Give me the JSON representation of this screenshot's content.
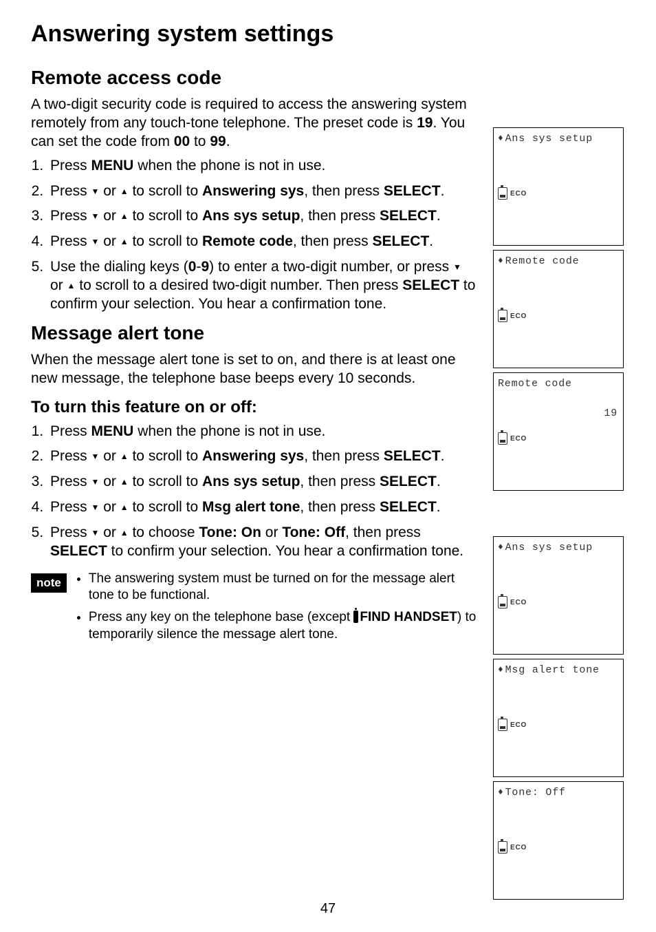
{
  "title": "Answering system settings",
  "section1": {
    "heading": "Remote access code",
    "intro_pre": "A two-digit security code is required to access the answering system remotely from any touch-tone telephone. The preset code is ",
    "intro_code": "19",
    "intro_mid": ". You can set the code from ",
    "intro_from": "00",
    "intro_to_word": " to ",
    "intro_to": "99",
    "intro_end": ".",
    "steps": {
      "s1_pre": "Press ",
      "s1_bold": "MENU",
      "s1_post": " when the phone is not in use.",
      "s2_pre": "Press ",
      "s2_or": " or ",
      "s2_mid": " to scroll to ",
      "s2_bold": "Answering sys",
      "s2_then": ", then press ",
      "s2_sel": "SELECT",
      "s2_end": ".",
      "s3_bold": "Ans sys setup",
      "s4_bold": "Remote code",
      "s5_a": "Use the dialing keys (",
      "s5_zero": "0",
      "s5_dash": "-",
      "s5_nine": "9",
      "s5_b": ") to enter a two-digit number, or press ",
      "s5_c": " to scroll to a desired two-digit number. Then press ",
      "s5_sel": "SELECT",
      "s5_d": " to confirm your selection. You hear a confirmation tone."
    }
  },
  "section2": {
    "heading": "Message alert tone",
    "intro": "When the message alert tone is set to on, and there is at least one new message, the telephone base beeps every 10 seconds.",
    "subheading": "To turn this feature on or off:",
    "steps": {
      "s1_pre": "Press ",
      "s1_bold": "MENU",
      "s1_post": " when the phone is not in use.",
      "scroll_pre": "Press ",
      "scroll_or": " or ",
      "scroll_mid": " to scroll to ",
      "then": ", then press ",
      "sel": "SELECT",
      "end": ".",
      "s2_bold": "Answering sys",
      "s3_bold": "Ans sys setup",
      "s4_bold": "Msg alert tone",
      "s5_pre": "Press ",
      "s5_choose": " to choose ",
      "s5_on": "Tone: On",
      "s5_or": " or ",
      "s5_off": "Tone: Off",
      "s5_then": ", then press ",
      "s5_sel": "SELECT",
      "s5_post": " to confirm your selection. You hear a confirmation tone."
    },
    "note_label": "note",
    "notes": {
      "n1": "The answering system must be turned on for the message alert tone to be functional.",
      "n2_pre": "Press any key on the telephone base (except ",
      "n2_bold": "FIND HANDSET",
      "n2_post": ") to temporarily silence the message alert tone."
    }
  },
  "screens": {
    "s1": "Ans sys setup",
    "s2": "Remote code",
    "s3_title": "Remote code",
    "s3_value": "19",
    "s4": "Ans sys setup",
    "s5": "Msg alert tone",
    "s6": "Tone: Off",
    "eco": "ECO"
  },
  "page_number": "47"
}
